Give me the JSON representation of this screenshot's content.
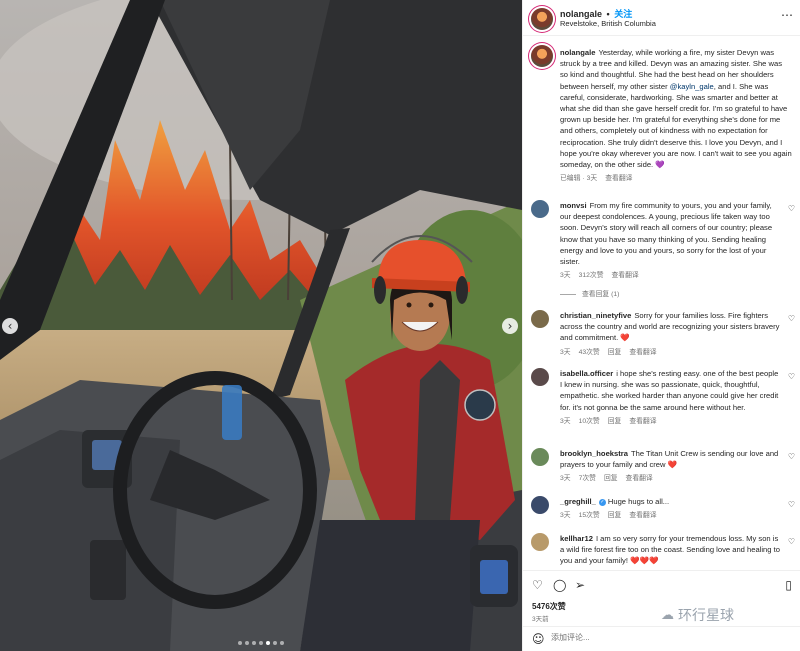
{
  "post": {
    "username": "nolangale",
    "follow_label": "关注",
    "separator": "•",
    "location": "Revelstoke, British Columbia",
    "more_icon": "more-horizontal-icon"
  },
  "caption": {
    "username": "nolangale",
    "text_before_mention": "Yesterday, while working a fire, my sister Devyn was struck by a tree and killed. Devyn was an amazing sister. She was so kind and thoughtful. She had the best head on her shoulders between herself, my other sister ",
    "mention": "@kayln_gale",
    "text_after_mention": ", and I. She was careful, considerate, hardworking. She was smarter and better at what she did than she gave herself credit for. I'm so grateful to have grown up beside her. I'm grateful for everything she's done for me and others, completely out of kindness with no expectation for reciprocation. She truly didn't deserve this. I love you Devyn, and I hope you're okay wherever you are now. I can't wait to see you again someday, on the other side. ",
    "emoji": "💜",
    "edited": "已编辑",
    "sep": "·",
    "age": "3天",
    "translate": "查看翻译"
  },
  "comments": [
    {
      "username": "monvsi",
      "text": "From my fire community to yours, you and your family, our deepest condolences. A young, precious life taken way too soon. Devyn's story will reach all corners of our country; please know that you have so many thinking of you. Sending healing energy and love to you and yours, so sorry for the lost of your sister.",
      "age": "3天",
      "likes": "312次赞",
      "reply": "",
      "translate": "查看翻译",
      "view_replies": "查看回复 (1)",
      "avatar_color": "#4a6a8a"
    },
    {
      "username": "christian_ninetyfive",
      "text": "Sorry for your families loss. Fire fighters across the country and world are recognizing your sisters bravery and commitment. ",
      "emoji": "❤️",
      "age": "3天",
      "likes": "43次赞",
      "reply": "回复",
      "translate": "查看翻译",
      "avatar_color": "#7a6a4a"
    },
    {
      "username": "isabella.officer",
      "text": "i hope she's resting easy. one of the best people I knew in nursing. she was so passionate, quick, thoughtful, empathetic. she worked harder than anyone could give her credit for. it's not gonna be the same around here without her.",
      "age": "3天",
      "likes": "10次赞",
      "reply": "回复",
      "translate": "查看翻译",
      "avatar_color": "#5a4a4a"
    },
    {
      "username": "brooklyn_hoekstra",
      "text": "The Titan Unit Crew is sending our love and prayers to your family and crew ",
      "emoji": "❤️",
      "age": "3天",
      "likes": "7次赞",
      "reply": "回复",
      "translate": "查看翻译",
      "avatar_color": "#6a8a5a"
    },
    {
      "username": "_greghill_",
      "text": "Huge hugs to all...",
      "age": "3天",
      "likes": "15次赞",
      "reply": "回复",
      "translate": "查看翻译",
      "avatar_color": "#3a4a6a"
    },
    {
      "username": "kellhar12",
      "text": "I am so very sorry for your tremendous loss. My son is a wild fire forest fire too on the coast. Sending love and healing to you and your family! ",
      "emoji": "❤️❤️❤️",
      "age": "",
      "likes": "",
      "reply": "",
      "translate": "",
      "avatar_color": "#b89a6a"
    }
  ],
  "actions": {
    "like_icon": "heart-outline-icon",
    "comment_icon": "comment-icon",
    "share_icon": "share-icon",
    "save_icon": "bookmark-icon",
    "likes": "5476次赞",
    "date": "3天前"
  },
  "watermark": {
    "text": "环行星球"
  },
  "add_comment": {
    "placeholder": "添加评论..."
  },
  "carousel": {
    "dot_count": 7,
    "active_index": 4
  }
}
